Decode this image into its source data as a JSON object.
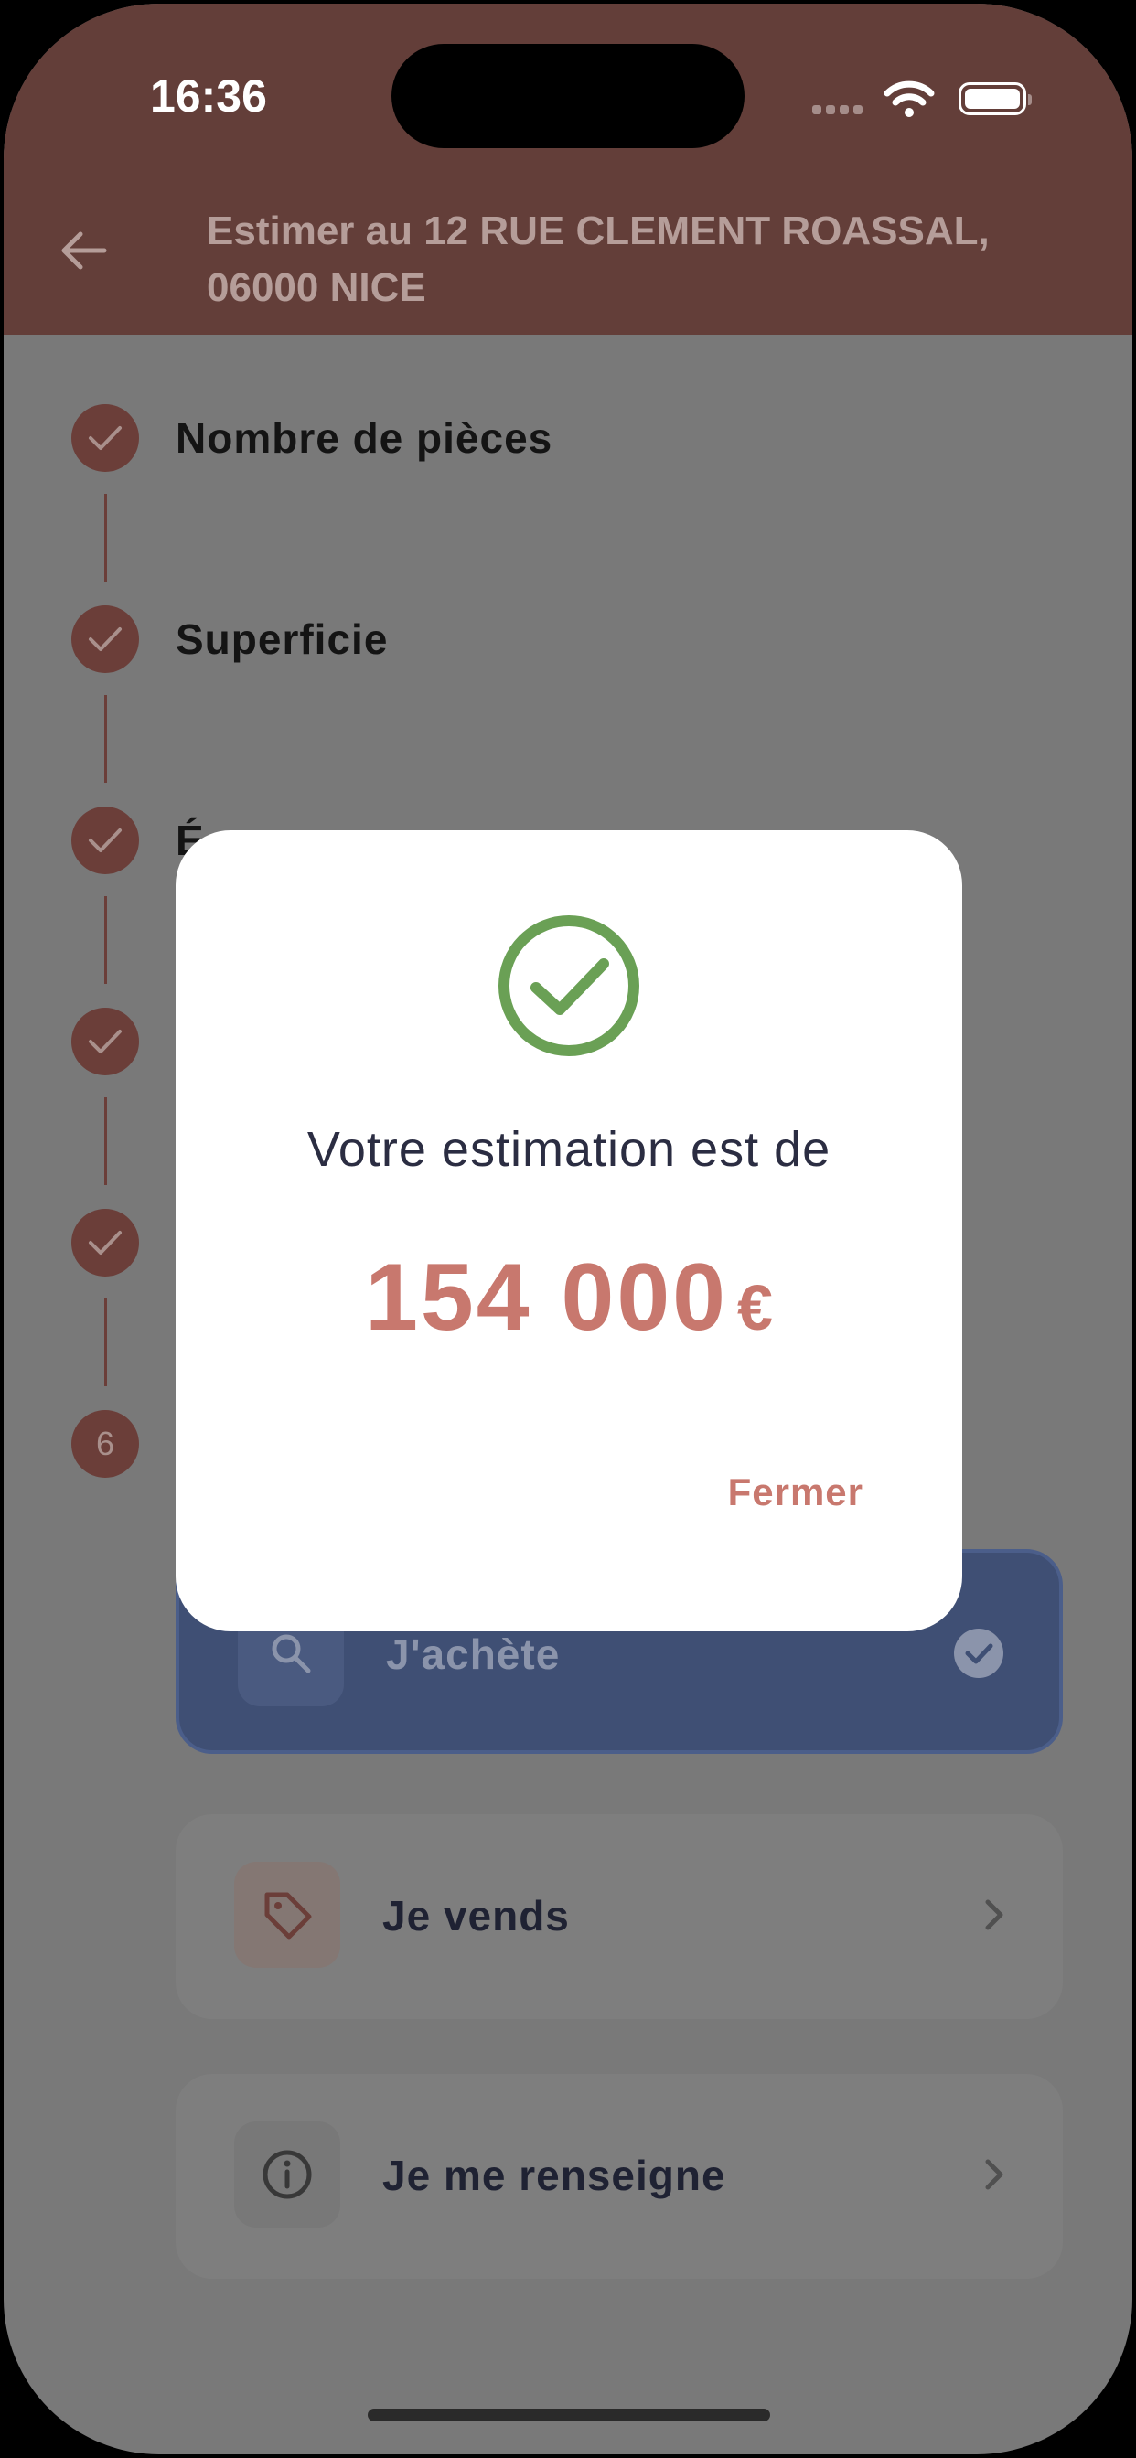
{
  "status_bar": {
    "time": "16:36"
  },
  "header": {
    "title": "Estimer au 12 RUE CLEMENT ROASSAL, 06000 NICE"
  },
  "steps": [
    {
      "label": "Nombre de pièces",
      "state": "done"
    },
    {
      "label": "Superficie",
      "state": "done"
    },
    {
      "label": "É",
      "state": "done"
    },
    {
      "label": "",
      "state": "done"
    },
    {
      "label": "",
      "state": "done"
    },
    {
      "label": "",
      "number": "6",
      "state": "current"
    }
  ],
  "options": [
    {
      "label": "J'achète",
      "icon": "search-icon",
      "selected": true
    },
    {
      "label": "Je vends",
      "icon": "tag-icon",
      "selected": false
    },
    {
      "label": "Je me renseigne",
      "icon": "info-icon",
      "selected": false
    }
  ],
  "dialog": {
    "message": "Votre estimation est de",
    "amount": "154 000",
    "currency": "€",
    "close_label": "Fermer"
  },
  "colors": {
    "header_bg": "#633e39",
    "accent": "#c8786e",
    "success": "#6aa055",
    "selected_card": "#3f4f74"
  }
}
